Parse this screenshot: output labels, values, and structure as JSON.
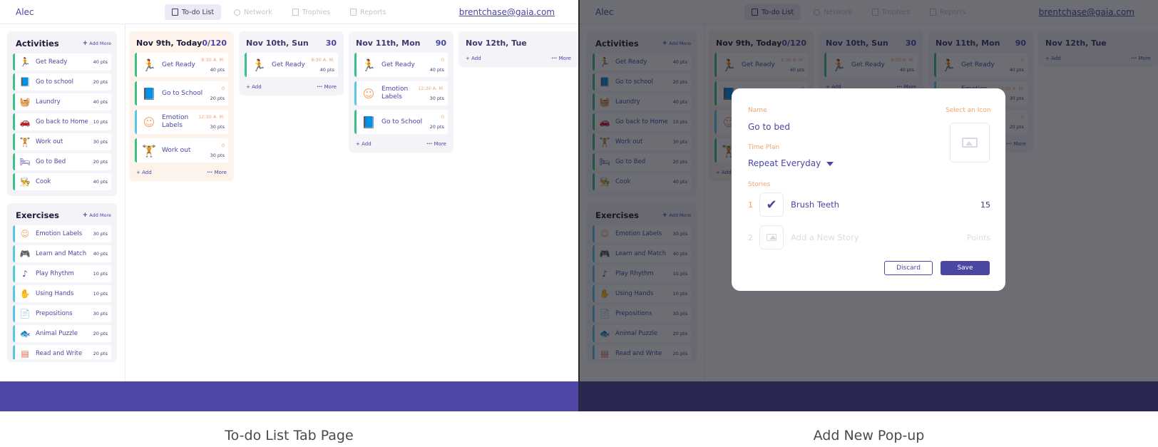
{
  "nav": {
    "user": "Alec",
    "tabs": [
      {
        "label": "To-do List",
        "active": true
      },
      {
        "label": "Network",
        "active": false
      },
      {
        "label": "Trophies",
        "active": false
      },
      {
        "label": "Reports",
        "active": false
      }
    ],
    "email": "brentchase@gaia.com"
  },
  "sidebar": {
    "add_more": "Add More",
    "activities": {
      "title": "Activities",
      "items": [
        {
          "label": "Get Ready",
          "pts": "40 pts",
          "icon": "running-person-icon",
          "bar": "#3cc08a"
        },
        {
          "label": "Go to school",
          "pts": "20 pts",
          "icon": "book-icon",
          "bar": "#3cc08a"
        },
        {
          "label": "Laundry",
          "pts": "40 pts",
          "icon": "laundry-icon",
          "bar": "#3cc08a"
        },
        {
          "label": "Go back to Home",
          "pts": "10 pts",
          "icon": "car-icon",
          "bar": "#3cc08a"
        },
        {
          "label": "Work out",
          "pts": "30 pts",
          "icon": "dumbbell-icon",
          "bar": "#3cc08a"
        },
        {
          "label": "Go to Bed",
          "pts": "20 pts",
          "icon": "bed-icon",
          "bar": "#3cc08a"
        },
        {
          "label": "Cook",
          "pts": "40 pts",
          "icon": "chef-hat-icon",
          "bar": "#3cc08a"
        }
      ]
    },
    "exercises": {
      "title": "Exercises",
      "items": [
        {
          "label": "Emotion Labels",
          "pts": "30 pts",
          "icon": "smiley-icon",
          "bar": "#5bc7e8"
        },
        {
          "label": "Learn and Match",
          "pts": "40 pts",
          "icon": "gamepad-icon",
          "bar": "#5bc7e8"
        },
        {
          "label": "Play Rhythm",
          "pts": "10 pts",
          "icon": "music-note-icon",
          "bar": "#5bc7e8"
        },
        {
          "label": "Using Hands",
          "pts": "10 pts",
          "icon": "hands-icon",
          "bar": "#5bc7e8"
        },
        {
          "label": "Prepositions",
          "pts": "30 pts",
          "icon": "document-icon",
          "bar": "#5bc7e8"
        },
        {
          "label": "Animal Puzzle",
          "pts": "20 pts",
          "icon": "fish-icon",
          "bar": "#5bc7e8"
        },
        {
          "label": "Read and Write",
          "pts": "20 pts",
          "icon": "tablet-icon",
          "bar": "#5bc7e8"
        }
      ]
    }
  },
  "days": [
    {
      "date": "Nov 9th, Today",
      "score": "0/120",
      "today": true,
      "cards": [
        {
          "label": "Get Ready",
          "time": "8:30 A. M.",
          "pts": "40 pts",
          "icon": "running-person-icon",
          "bar": "#3cc08a"
        },
        {
          "label": "Go to School",
          "time": "0",
          "pts": "20 pts",
          "icon": "book-icon",
          "bar": "#3cc08a"
        },
        {
          "label": "Emotion Labels",
          "time": "12:30 A. M.",
          "pts": "30 pts",
          "icon": "smiley-icon",
          "bar": "#5bc7e8"
        },
        {
          "label": "Work out",
          "time": "0",
          "pts": "30 pts",
          "icon": "dumbbell-icon",
          "bar": "#3cc08a"
        }
      ]
    },
    {
      "date": "Nov 10th, Sun",
      "score": "30",
      "today": false,
      "cards": [
        {
          "label": "Get Ready",
          "time": "8:30 A. M.",
          "pts": "40 pts",
          "icon": "running-person-icon",
          "bar": "#3cc08a"
        }
      ]
    },
    {
      "date": "Nov 11th, Mon",
      "score": "90",
      "today": false,
      "cards": [
        {
          "label": "Get Ready",
          "time": "0",
          "pts": "40 pts",
          "icon": "running-person-icon",
          "bar": "#3cc08a"
        },
        {
          "label": "Emotion Labels",
          "time": "12:30 A. M.",
          "pts": "30 pts",
          "icon": "smiley-icon",
          "bar": "#5bc7e8"
        },
        {
          "label": "Go to School",
          "time": "0",
          "pts": "20 pts",
          "icon": "book-icon",
          "bar": "#3cc08a"
        }
      ]
    },
    {
      "date": "Nov 12th, Tue",
      "score": "",
      "today": false,
      "cards": []
    }
  ],
  "col_actions": {
    "add": "Add",
    "more": "More"
  },
  "modal": {
    "name_label": "Name",
    "name_value": "Go to bed",
    "select_icon": "Select an Icon",
    "time_plan_label": "Time Plan",
    "time_plan_value": "Repeat Everyday",
    "stories_label": "Stories",
    "stories": [
      {
        "num": "1",
        "label": "Brush Teeth",
        "pts": "15"
      }
    ],
    "new_story": {
      "num": "2",
      "placeholder": "Add a New Story",
      "pts_placeholder": "Points"
    },
    "discard": "Discard",
    "save": "Save"
  },
  "captions": {
    "left": "To-do List Tab Page",
    "right": "Add New Pop-up"
  },
  "colors": {
    "accent": "#4a47a3",
    "footer": "#5048a8",
    "orange": "#f2a46b",
    "green_bar": "#3cc08a",
    "blue_bar": "#5bc7e8"
  }
}
